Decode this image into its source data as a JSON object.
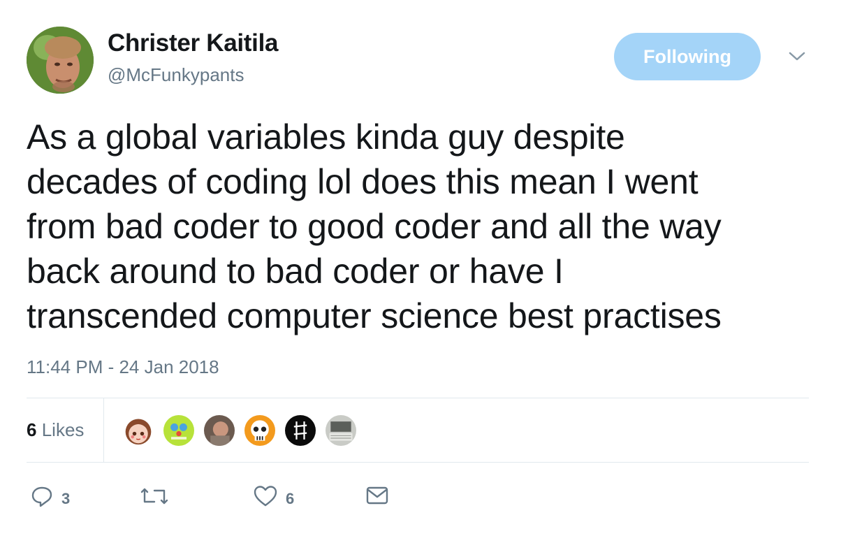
{
  "user": {
    "name": "Christer Kaitila",
    "handle": "@McFunkypants",
    "avatar_icon": "profile-photo"
  },
  "follow": {
    "label": "Following",
    "color": "#a4d4f8"
  },
  "tweet": {
    "text": "As a global variables kinda guy despite\ndecades of coding lol does this mean I went\nfrom bad coder to good coder and all the way\nback around to bad coder or have I\ntranscended computer science best practises",
    "timestamp": "11:44 PM - 24 Jan 2018"
  },
  "stats": {
    "likes_count": "6",
    "likes_label": "Likes",
    "likers": [
      "cartoon-girl-avatar",
      "green-robot-avatar",
      "photo-avatar",
      "skull-avatar",
      "black-logo-avatar",
      "keyboard-photo-avatar"
    ]
  },
  "actions": {
    "reply_count": "3",
    "like_count": "6"
  },
  "colors": {
    "text": "#14171a",
    "muted": "#657786",
    "divider": "#e1e8ed"
  }
}
